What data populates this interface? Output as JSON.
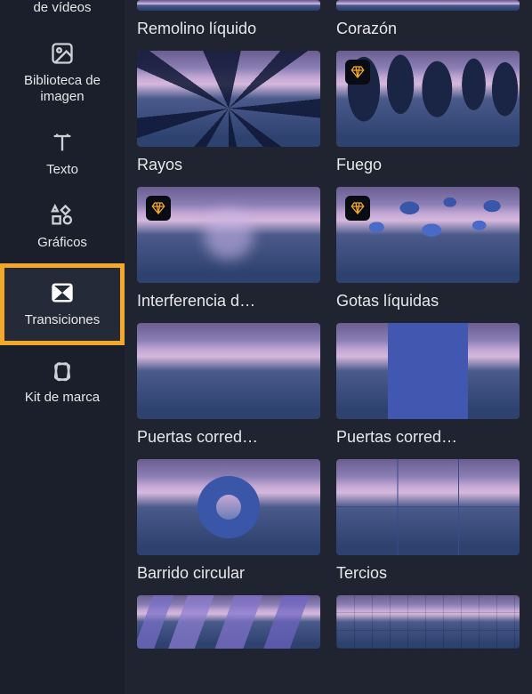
{
  "sidebar": {
    "items": [
      {
        "label": "de vídeos"
      },
      {
        "label": "Biblioteca de imagen"
      },
      {
        "label": "Texto"
      },
      {
        "label": "Gráficos"
      },
      {
        "label": "Transiciones"
      },
      {
        "label": "Kit de marca"
      }
    ],
    "selected_index": 4
  },
  "icons": {
    "diamond": "premium-diamond"
  },
  "transitions": [
    {
      "label": "Remolino líquido",
      "premium": false,
      "fx": ""
    },
    {
      "label": "Corazón",
      "premium": false,
      "fx": ""
    },
    {
      "label": "Rayos",
      "premium": false,
      "fx": "rays"
    },
    {
      "label": "Fuego",
      "premium": true,
      "fx": "fire"
    },
    {
      "label": "Interferencia d…",
      "premium": true,
      "fx": "interference"
    },
    {
      "label": "Gotas líquidas",
      "premium": true,
      "fx": "drops"
    },
    {
      "label": "Puertas corred…",
      "premium": false,
      "fx": ""
    },
    {
      "label": "Puertas corred…",
      "premium": false,
      "fx": "doors-h"
    },
    {
      "label": "Barrido circular",
      "premium": false,
      "fx": "circle"
    },
    {
      "label": "Tercios",
      "premium": false,
      "fx": "thirds"
    },
    {
      "label": "",
      "premium": false,
      "fx": "smear"
    },
    {
      "label": "",
      "premium": false,
      "fx": "pixel"
    }
  ]
}
